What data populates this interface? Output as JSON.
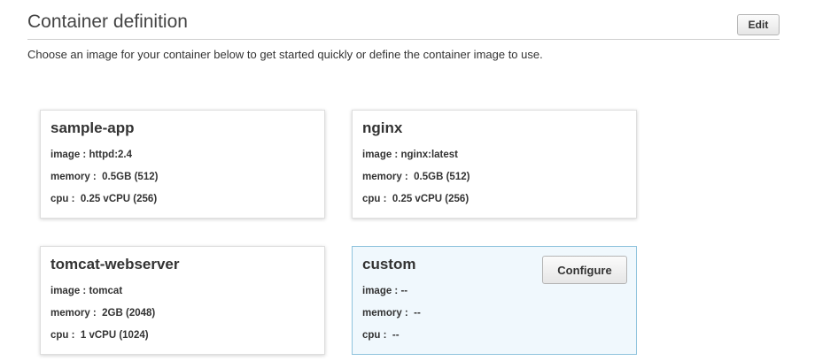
{
  "section": {
    "title": "Container definition",
    "edit_label": "Edit",
    "description": "Choose an image for your container below to get started quickly or define the container image to use."
  },
  "containers": [
    {
      "name": "sample-app",
      "image_line": "image : httpd:2.4",
      "memory_line": "memory :  0.5GB (512)",
      "cpu_line": "cpu :  0.25 vCPU (256)"
    },
    {
      "name": "nginx",
      "image_line": "image : nginx:latest",
      "memory_line": "memory :  0.5GB (512)",
      "cpu_line": "cpu :  0.25 vCPU (256)"
    },
    {
      "name": "tomcat-webserver",
      "image_line": "image : tomcat",
      "memory_line": "memory :  2GB (2048)",
      "cpu_line": "cpu :  1 vCPU (1024)"
    },
    {
      "name": "custom",
      "image_line": "image : --",
      "memory_line": "memory :  --",
      "cpu_line": "cpu :  --",
      "configure_label": "Configure",
      "selected": true
    }
  ],
  "colors": {
    "selected_background": "#f0f8fd",
    "selected_border": "#8fc3dd"
  }
}
